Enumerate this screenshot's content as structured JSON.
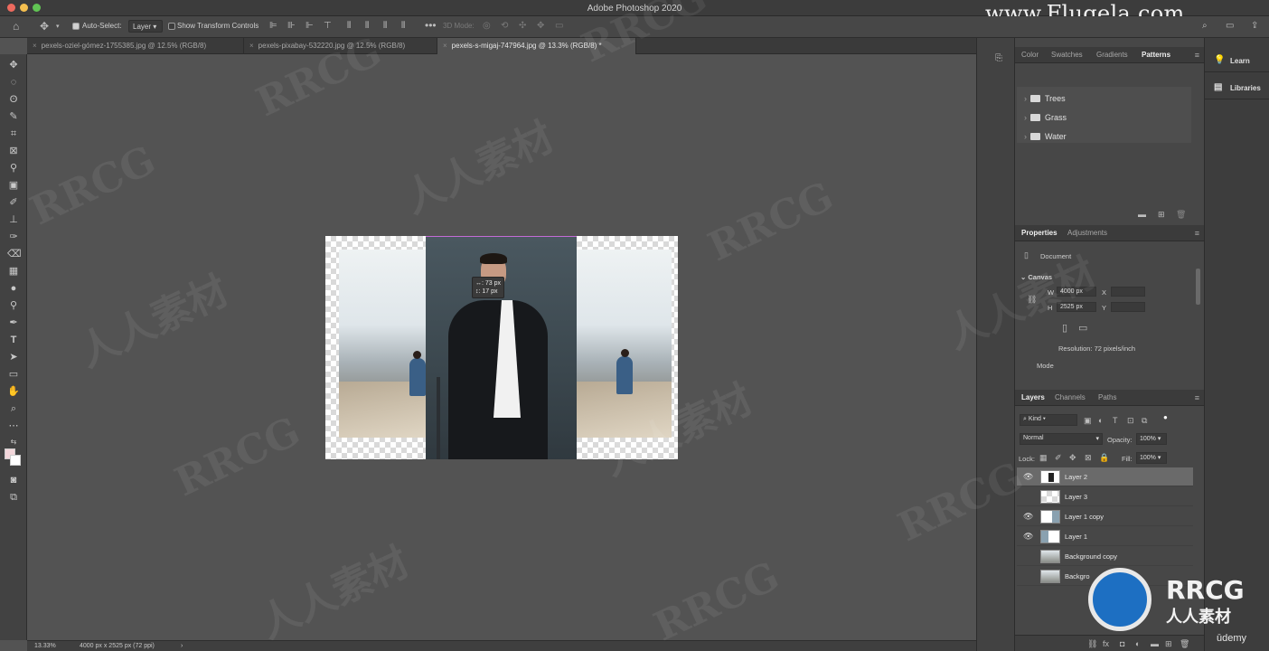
{
  "window": {
    "title": "Adobe Photoshop 2020",
    "watermark_url": "www.Flugela.com"
  },
  "options_bar": {
    "auto_select_label": "Auto-Select:",
    "auto_select_value": "Layer",
    "show_transform_label": "Show Transform Controls",
    "mode_3d": "3D Mode:"
  },
  "tabs": [
    {
      "label": "pexels-oziel-gómez-1755385.jpg @ 12.5% (RGB/8)"
    },
    {
      "label": "pexels-pixabay-532220.jpg @ 12.5% (RGB/8)"
    },
    {
      "label": "pexels-s-migaj-747964.jpg @ 13.3% (RGB/8) *"
    }
  ],
  "tooltip": {
    "line1": "↔: 73 px",
    "line2": "↕: 17 px"
  },
  "status": {
    "zoom": "13.33%",
    "doc_info": "4000 px x 2525 px (72 ppi)"
  },
  "patterns_panel": {
    "tabs": [
      "Color",
      "Swatches",
      "Gradients",
      "Patterns"
    ],
    "folders": [
      "Trees",
      "Grass",
      "Water"
    ]
  },
  "properties_panel": {
    "tabs": [
      "Properties",
      "Adjustments"
    ],
    "document_label": "Document",
    "canvas_label": "Canvas",
    "w_label": "W",
    "w_value": "4000 px",
    "x_label": "X",
    "h_label": "H",
    "h_value": "2525 px",
    "y_label": "Y",
    "resolution": "Resolution: 72 pixels/inch",
    "mode_label": "Mode"
  },
  "layers_panel": {
    "tabs": [
      "Layers",
      "Channels",
      "Paths"
    ],
    "kind_label": "Kind",
    "blend_mode": "Normal",
    "opacity_label": "Opacity:",
    "opacity_value": "100%",
    "lock_label": "Lock:",
    "fill_label": "Fill:",
    "fill_value": "100%",
    "layers": [
      {
        "name": "Layer 2",
        "visible": true,
        "selected": true
      },
      {
        "name": "Layer 3",
        "visible": false,
        "selected": false
      },
      {
        "name": "Layer 1 copy",
        "visible": true,
        "selected": false
      },
      {
        "name": "Layer 1",
        "visible": true,
        "selected": false
      },
      {
        "name": "Background copy",
        "visible": false,
        "selected": false
      },
      {
        "name": "Backgro",
        "visible": false,
        "selected": false
      }
    ]
  },
  "far_panel": {
    "learn": "Learn",
    "libraries": "Libraries"
  },
  "overlay": {
    "brand": "RRCG",
    "brand_sub": "人人素材",
    "udemy": "ūdemy",
    "wm_text": "RRCG",
    "wm_cn": "人人素材"
  }
}
